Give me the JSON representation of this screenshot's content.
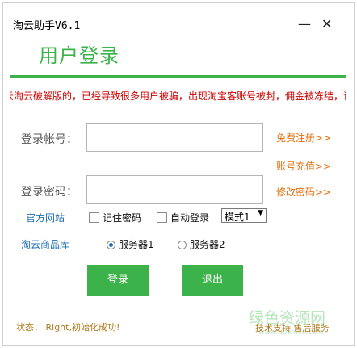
{
  "window": {
    "title": "淘云助手V6.1",
    "minimize": "—",
    "close": "✕"
  },
  "heading": "用户登录",
  "notice": "云淘云破解版的，已经导致很多用户被骗，出现淘宝客账号被封，佣金被冻结，请",
  "account_label": "登录帐号：",
  "password_label": "登录密码：",
  "account_value": "",
  "password_value": "",
  "links": {
    "register": "免费注册>>",
    "recharge": "账号充值>>",
    "change_password": "修改密码>>",
    "official_site": "官方网站",
    "store": "淘云商品库"
  },
  "options": {
    "remember": "记住密码",
    "autologin": "自动登录",
    "mode": "模式1"
  },
  "servers": [
    {
      "label": "服务器1",
      "selected": true
    },
    {
      "label": "服务器2",
      "selected": false
    }
  ],
  "buttons": {
    "login": "登录",
    "exit": "退出"
  },
  "status": "状态：  Right,初始化成功!",
  "footer_right": "技术支持  售后服务",
  "watermark": {
    "top": "绿色资源网",
    "bottom": "www.downcc.com"
  },
  "colors": {
    "accent": "#3cb34a",
    "notice": "#cc0000",
    "link_orange": "#e36c09",
    "link_blue": "#1f6fb3"
  }
}
